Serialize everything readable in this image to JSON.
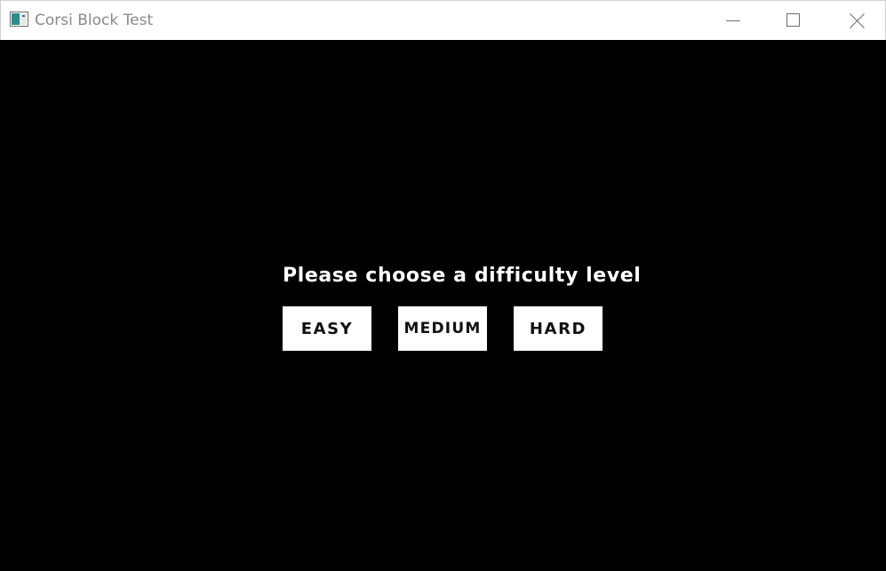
{
  "window": {
    "title": "Corsi Block Test",
    "icon": "app-window-icon",
    "controls": {
      "minimize_icon": "minimize-icon",
      "maximize_icon": "maximize-icon",
      "close_icon": "close-icon"
    }
  },
  "main": {
    "prompt": "Please choose a difficulty level",
    "buttons": [
      {
        "label": "EASY"
      },
      {
        "label": "MEDIUM"
      },
      {
        "label": "HARD"
      }
    ]
  },
  "colors": {
    "background": "#000000",
    "titlebar": "#ffffff",
    "button_background": "#ffffff",
    "button_text": "#111111",
    "prompt_text": "#ffffff"
  }
}
